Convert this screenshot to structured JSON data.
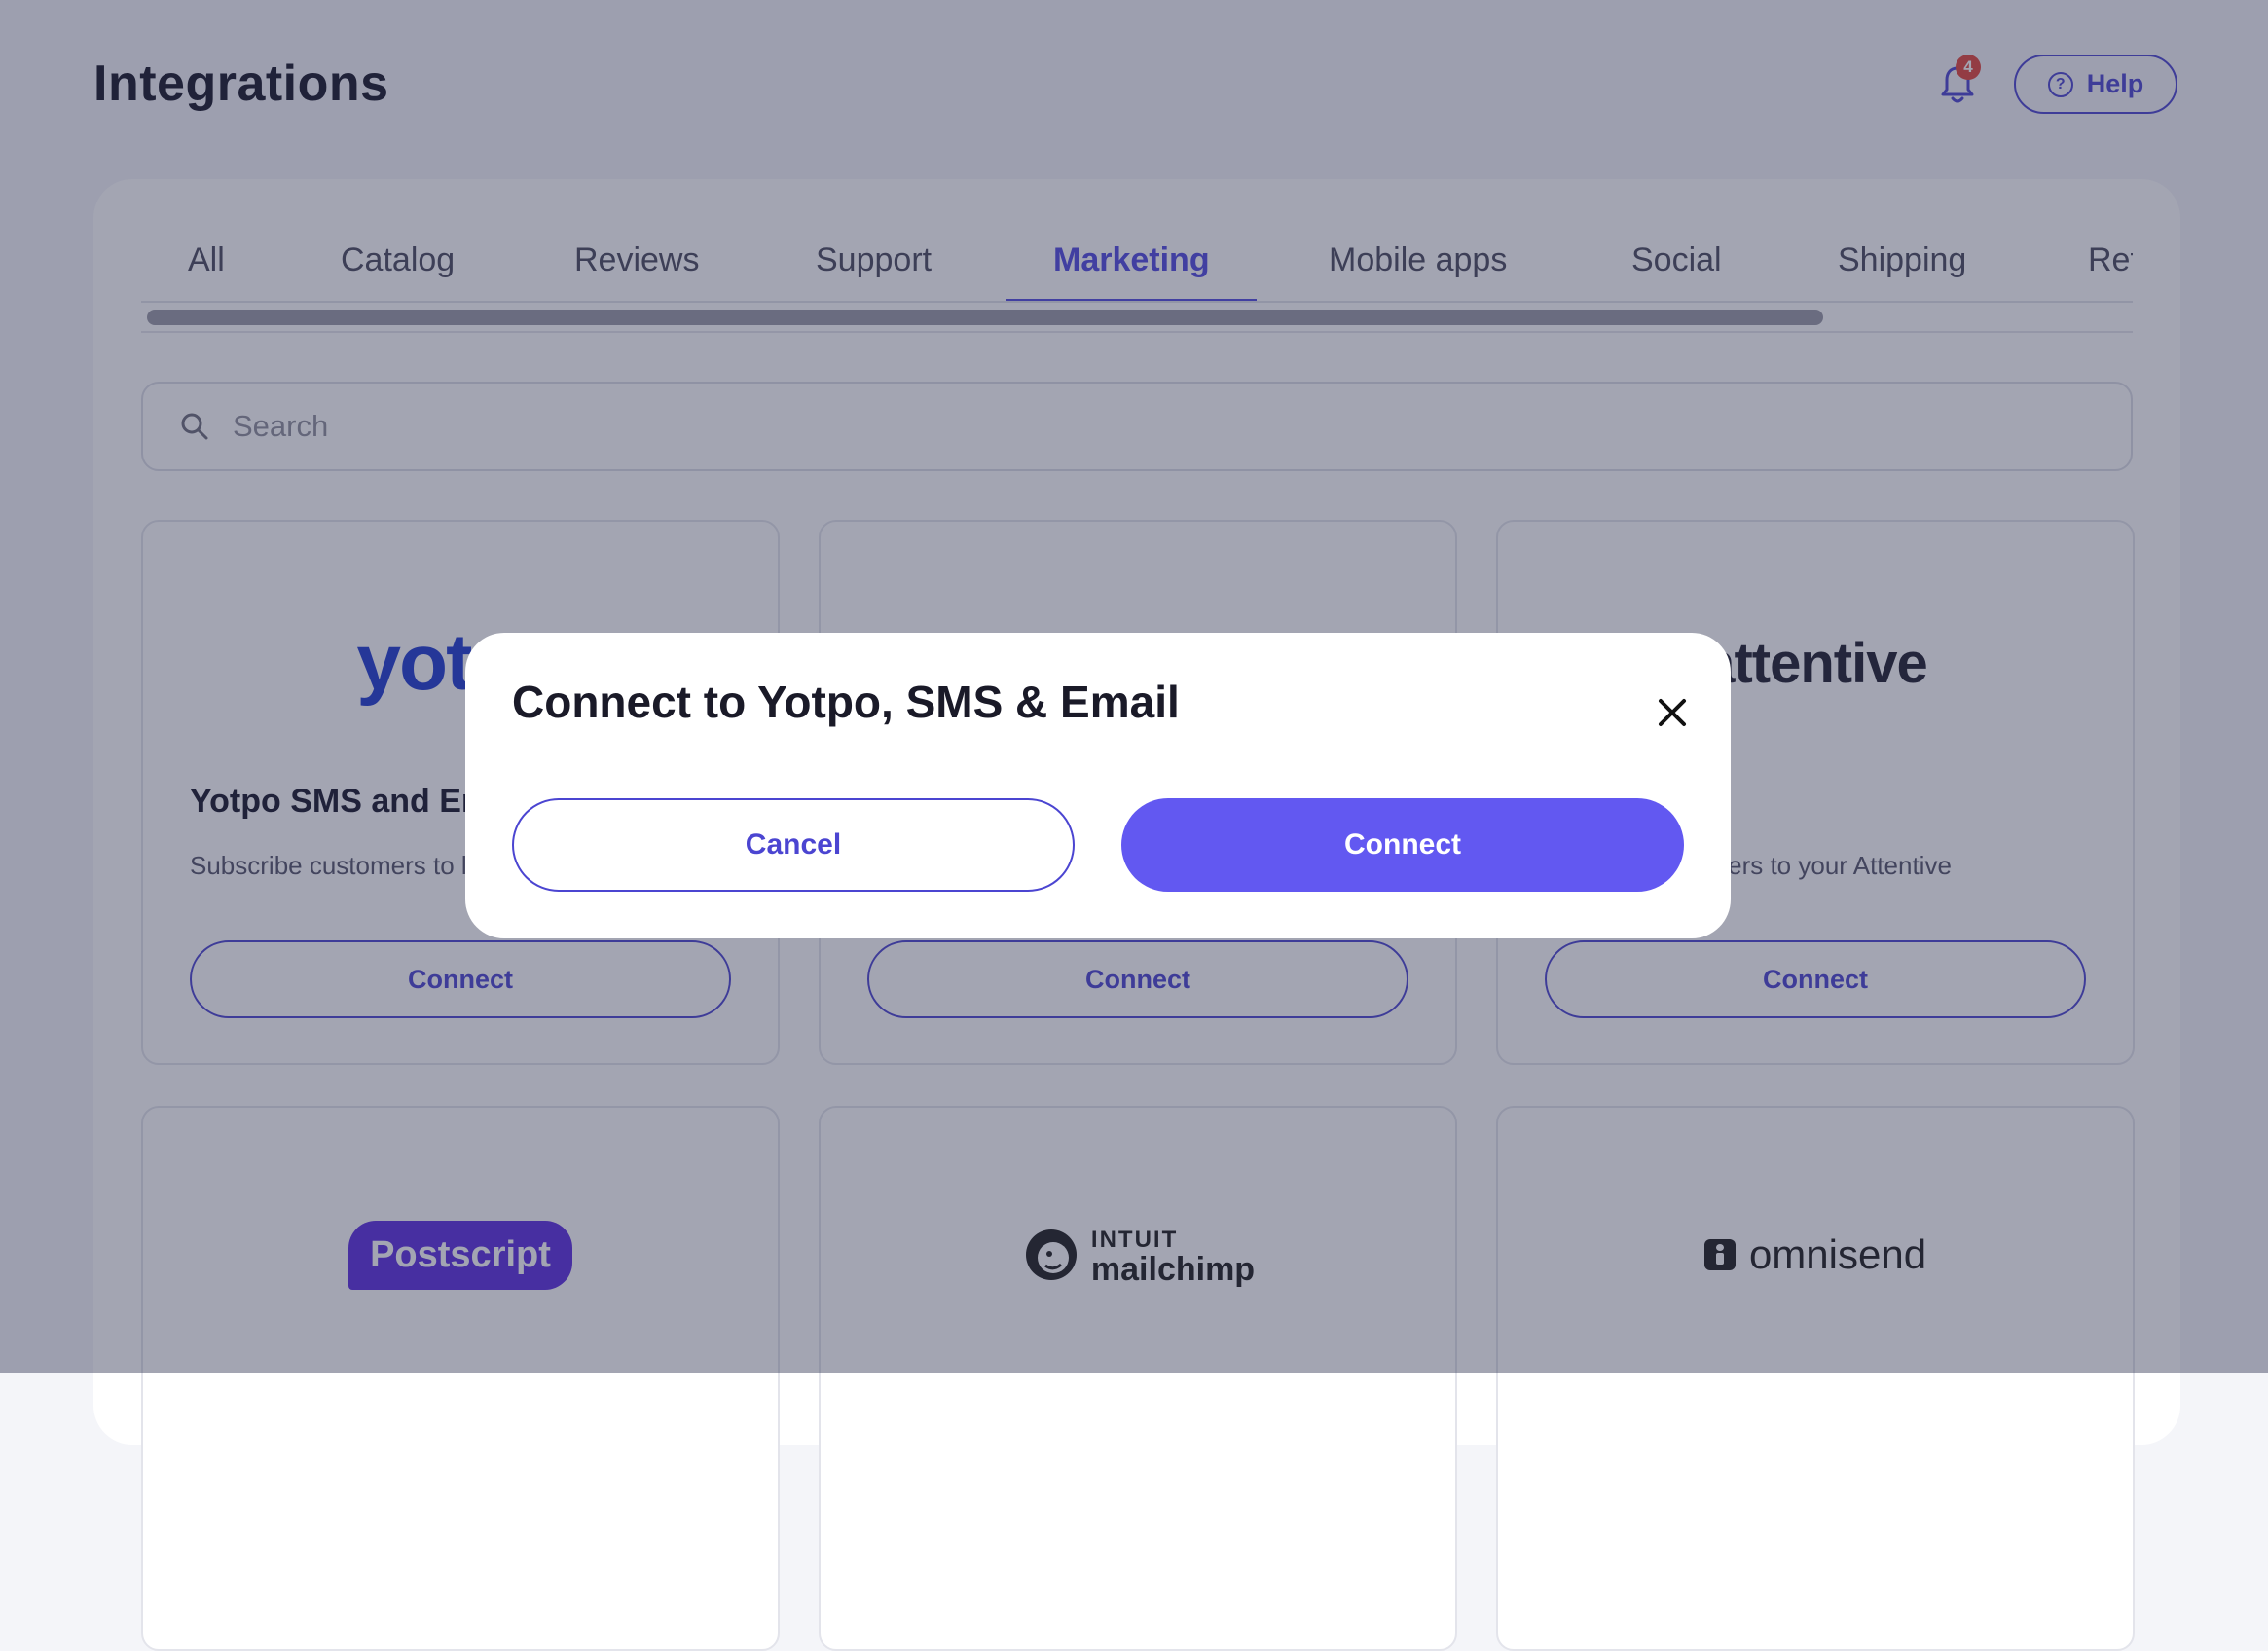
{
  "header": {
    "title": "Integrations",
    "notifications_count": "4",
    "help_label": "Help"
  },
  "tabs": [
    {
      "label": "All"
    },
    {
      "label": "Catalog"
    },
    {
      "label": "Reviews"
    },
    {
      "label": "Support"
    },
    {
      "label": "Marketing"
    },
    {
      "label": "Mobile apps"
    },
    {
      "label": "Social"
    },
    {
      "label": "Shipping"
    },
    {
      "label": "Ret"
    }
  ],
  "active_tab": "Marketing",
  "search": {
    "placeholder": "Search",
    "value": ""
  },
  "cards": [
    {
      "logo_text": "yotpo",
      "name": "Yotpo SMS and Er",
      "description": "Subscribe customers to lists",
      "button": "Connect"
    },
    {
      "logo_text": "",
      "name": "",
      "description": "",
      "button": "Connect"
    },
    {
      "logo_text": "attentive",
      "name": "",
      "description": "omers to your Attentive",
      "button": "Connect"
    },
    {
      "logo_text": "Postscript"
    },
    {
      "logo_text_top": "INTUIT",
      "logo_text_bottom": "mailchimp"
    },
    {
      "logo_text": "omnisend"
    }
  ],
  "modal": {
    "title": "Connect to Yotpo, SMS & Email",
    "cancel_label": "Cancel",
    "connect_label": "Connect"
  },
  "colors": {
    "accent": "#5149e0",
    "primary_button": "#6258f1",
    "badge": "#e3443b",
    "overlay": "rgba(45,50,80,0.44)"
  }
}
